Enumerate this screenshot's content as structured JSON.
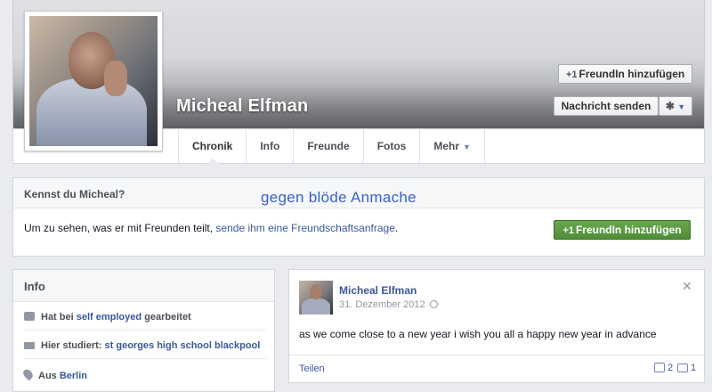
{
  "profile": {
    "name": "Micheal Elfman",
    "add_friend_label": "FreundIn hinzufügen",
    "message_label": "Nachricht senden"
  },
  "nav": {
    "tabs": [
      "Chronik",
      "Info",
      "Freunde",
      "Fotos",
      "Mehr"
    ]
  },
  "know": {
    "title": "Kennst du Micheal?",
    "text": "Um zu sehen, was er mit Freunden teilt, ",
    "link": "sende ihm eine Freundschaftsanfrage",
    "text_end": ".",
    "button_label": "FreundIn hinzufügen"
  },
  "overlay_text": "gegen blöde Anmache",
  "info": {
    "title": "Info",
    "items": [
      {
        "prefix": "Hat bei ",
        "value": "self employed",
        "suffix": " gearbeitet"
      },
      {
        "prefix": "Hier studiert: ",
        "value": "st georges high school blackpool",
        "suffix": ""
      },
      {
        "prefix": "Aus ",
        "value": "Berlin",
        "suffix": ""
      }
    ]
  },
  "post": {
    "author": "Micheal Elfman",
    "date": "31. Dezember 2012",
    "text": "as we come close to a new year i wish you all a happy new year in advance",
    "share_label": "Teilen",
    "likes": "2",
    "comments": "1"
  },
  "icons": {
    "plus": "+1",
    "gear": "✱",
    "caret": "▼",
    "close": "✕"
  }
}
